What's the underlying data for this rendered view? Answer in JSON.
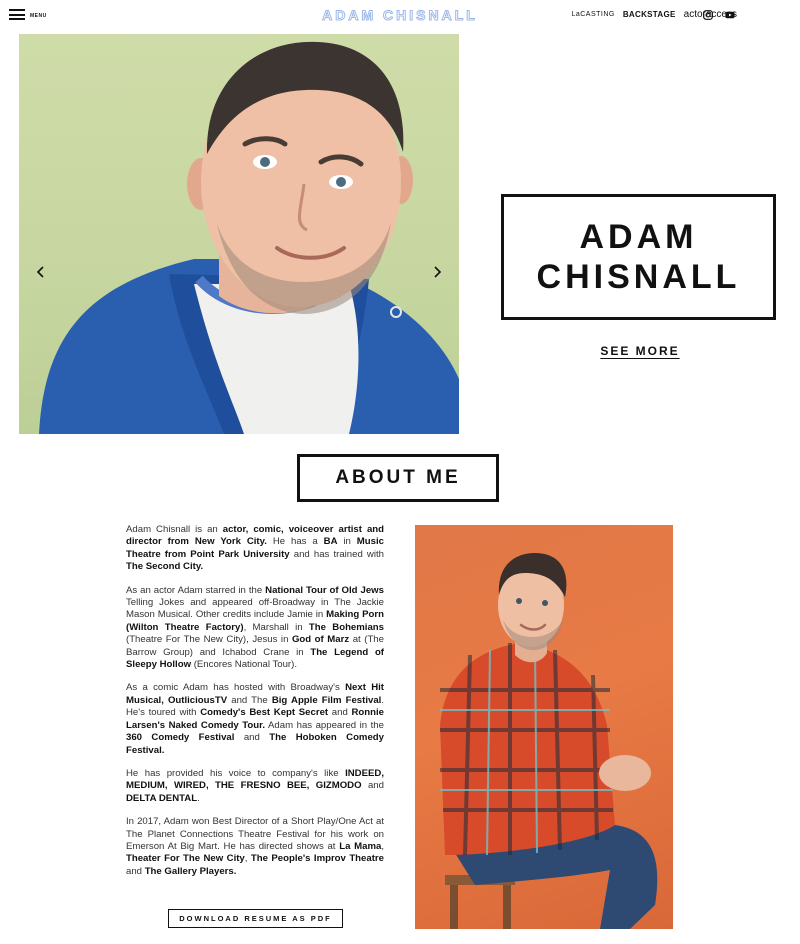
{
  "header": {
    "menu_label": "MENU",
    "brand": "ADAM CHISNALL",
    "links": [
      "LaCASTING",
      "BACKSTAGE",
      "actoraccess"
    ],
    "social_icons": [
      "instagram-icon",
      "youtube-icon"
    ]
  },
  "hero": {
    "name": "ADAM CHISNALL",
    "see_more": "SEE MORE",
    "carousel_controls": [
      "chevron-left-icon",
      "chevron-right-icon"
    ]
  },
  "about": {
    "heading": "ABOUT ME",
    "resume_button": "DOWNLOAD RESUME AS PDF"
  },
  "colors": {
    "brand_outline": "#9db8e8",
    "hero_bg": "#c7d6a0",
    "portrait_bg": "#e8743f",
    "hoodie": "#2a5fb0",
    "text": "#222222"
  }
}
